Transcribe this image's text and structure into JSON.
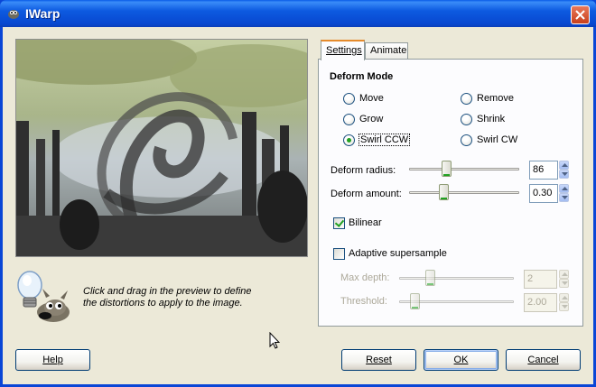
{
  "window": {
    "title": "IWarp",
    "close_icon": "close-icon",
    "app_icon": "gimp-icon"
  },
  "tabs": [
    {
      "label": "Settings",
      "active": true
    },
    {
      "label": "Animate",
      "active": false
    }
  ],
  "deform_mode": {
    "title": "Deform Mode",
    "options": [
      {
        "label": "Move",
        "checked": false
      },
      {
        "label": "Remove",
        "checked": false
      },
      {
        "label": "Grow",
        "checked": false
      },
      {
        "label": "Shrink",
        "checked": false
      },
      {
        "label": "Swirl CCW",
        "checked": true
      },
      {
        "label": "Swirl CW",
        "checked": false
      }
    ]
  },
  "deform_radius": {
    "label": "Deform radius:",
    "value": "86",
    "fraction": 0.33
  },
  "deform_amount": {
    "label": "Deform amount:",
    "value": "0.30",
    "fraction": 0.3
  },
  "bilinear": {
    "label": "Bilinear",
    "checked": true
  },
  "adaptive": {
    "label": "Adaptive supersample",
    "checked": false
  },
  "max_depth": {
    "label": "Max depth:",
    "value": "2",
    "fraction": 0.2
  },
  "threshold": {
    "label": "Threshold:",
    "value": "2.00",
    "fraction": 0.1
  },
  "hint": {
    "line1": "Click and drag in the preview to define",
    "line2": "the distortions to apply to the image.",
    "icon": "lightbulb-wilber-icon"
  },
  "buttons": {
    "help": "Help",
    "reset": "Reset",
    "ok": "OK",
    "cancel": "Cancel"
  },
  "colors": {
    "title_bar": "#0a5ce8",
    "dialog_bg": "#ece9d8",
    "check_mark": "#21a121",
    "tab_highlight": "#e68b2c"
  }
}
